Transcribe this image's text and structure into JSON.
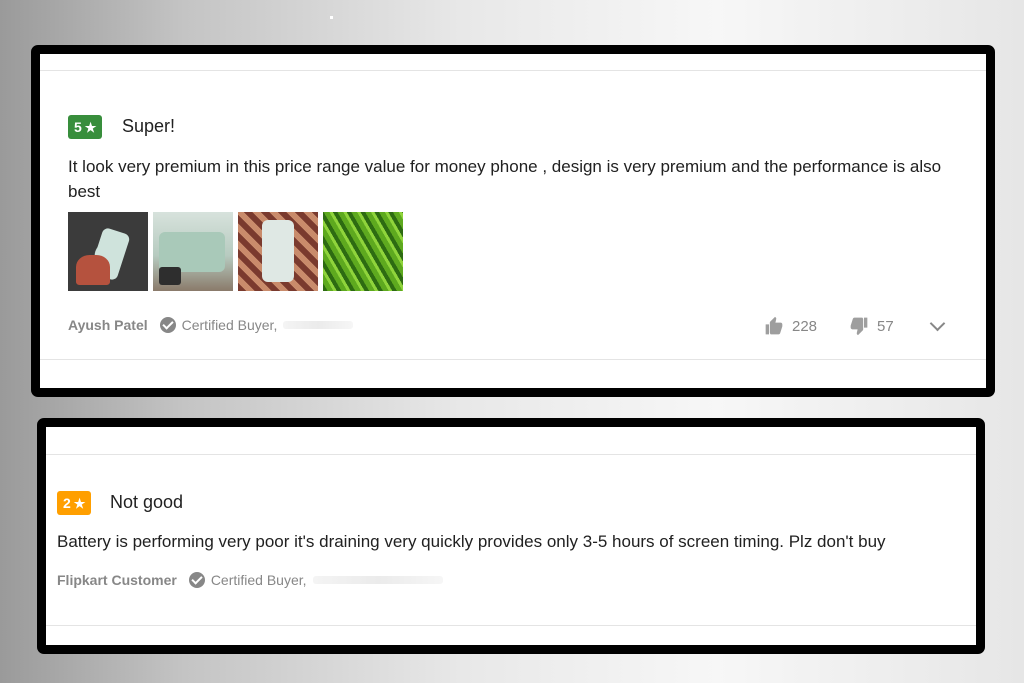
{
  "reviews": [
    {
      "rating": "5",
      "title": "Super!",
      "text": "It look very premium in this price range value for money phone , design is very premium and the performance is also best",
      "author": "Ayush Patel",
      "certified": "Certified Buyer,",
      "likes": "228",
      "dislikes": "57",
      "photos": [
        "phone-in-hand-photo",
        "phone-back-photo",
        "phone-on-cloth-photo",
        "green-grass-photo"
      ]
    },
    {
      "rating": "2",
      "title": "Not good",
      "text": "Battery is performing very poor it's draining very quickly provides only 3-5 hours of screen timing. Plz don't buy",
      "author": "Flipkart Customer",
      "certified": "Certified Buyer,"
    }
  ],
  "icons": {
    "star": "star-icon",
    "certified": "check-circle-icon",
    "like": "thumbs-up-icon",
    "dislike": "thumbs-down-icon",
    "more": "chevron-down-icon"
  },
  "colors": {
    "rating_high": "#388e3c",
    "rating_low": "#ff9f00",
    "muted_text": "#878787"
  }
}
